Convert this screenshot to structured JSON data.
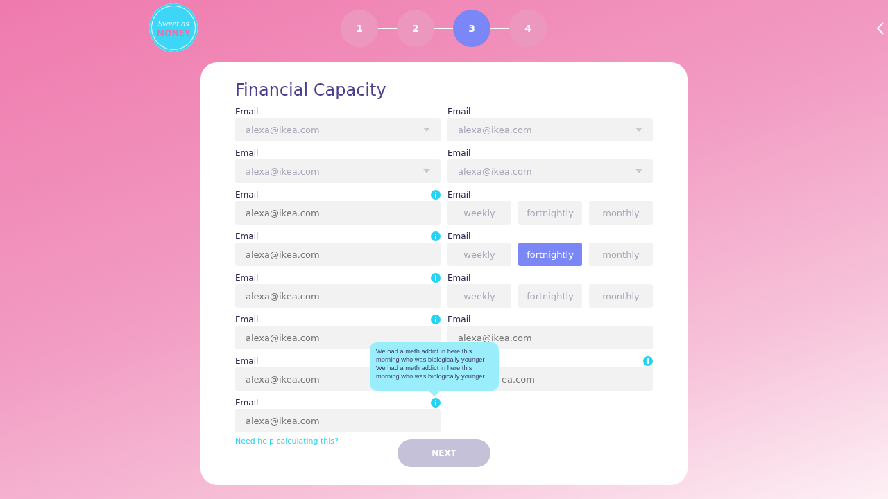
{
  "logo": {
    "line1": "Sweet as",
    "line2": "MONEY"
  },
  "steps": [
    {
      "label": "1",
      "selected": false
    },
    {
      "label": "2",
      "selected": false
    },
    {
      "label": "3",
      "selected": true
    },
    {
      "label": "4",
      "selected": false
    }
  ],
  "form": {
    "title": "Financial Capacity",
    "rows": [
      {
        "left": {
          "kind": "select",
          "label": "Email",
          "placeholder": "alexa@ikea.com",
          "info": false
        },
        "right": {
          "kind": "select",
          "label": "Email",
          "placeholder": "alexa@ikea.com",
          "info": false
        }
      },
      {
        "left": {
          "kind": "select",
          "label": "Email",
          "placeholder": "alexa@ikea.com",
          "info": false
        },
        "right": {
          "kind": "select",
          "label": "Email",
          "placeholder": "alexa@ikea.com",
          "info": false
        }
      },
      {
        "left": {
          "kind": "input",
          "label": "Email",
          "placeholder": "alexa@ikea.com",
          "info": true
        },
        "right": {
          "kind": "frequency",
          "label": "Email",
          "options": [
            {
              "label": "weekly",
              "selected": false
            },
            {
              "label": "fortnightly",
              "selected": false
            },
            {
              "label": "monthly",
              "selected": false
            }
          ]
        }
      },
      {
        "left": {
          "kind": "input",
          "label": "Email",
          "placeholder": "alexa@ikea.com",
          "info": true
        },
        "right": {
          "kind": "frequency",
          "label": "Email",
          "options": [
            {
              "label": "weekly",
              "selected": false
            },
            {
              "label": "fortnightly",
              "selected": true
            },
            {
              "label": "monthly",
              "selected": false
            }
          ]
        }
      },
      {
        "left": {
          "kind": "input",
          "label": "Email",
          "placeholder": "alexa@ikea.com",
          "info": true
        },
        "right": {
          "kind": "frequency",
          "label": "Email",
          "options": [
            {
              "label": "weekly",
              "selected": false
            },
            {
              "label": "fortnightly",
              "selected": false
            },
            {
              "label": "monthly",
              "selected": false
            }
          ]
        }
      },
      {
        "left": {
          "kind": "input",
          "label": "Email",
          "placeholder": "alexa@ikea.com",
          "info": true
        },
        "right": {
          "kind": "input",
          "label": "Email",
          "placeholder": "alexa@ikea.com",
          "info": false
        }
      },
      {
        "left": {
          "kind": "input",
          "label": "Email",
          "placeholder": "alexa@ikea.com",
          "info": false
        },
        "right": {
          "kind": "input",
          "placeholder": "ea.com",
          "info": true,
          "covered": true
        }
      },
      {
        "left": {
          "kind": "input",
          "label": "Email",
          "placeholder": "alexa@ikea.com",
          "info": true
        }
      }
    ],
    "help_link": "Need help calculating this?",
    "next_button": "NEXT",
    "tooltip": "We had a meth addict in here this morning who was biologically younger We had a meth addict in here this morning who was biologically younger"
  }
}
